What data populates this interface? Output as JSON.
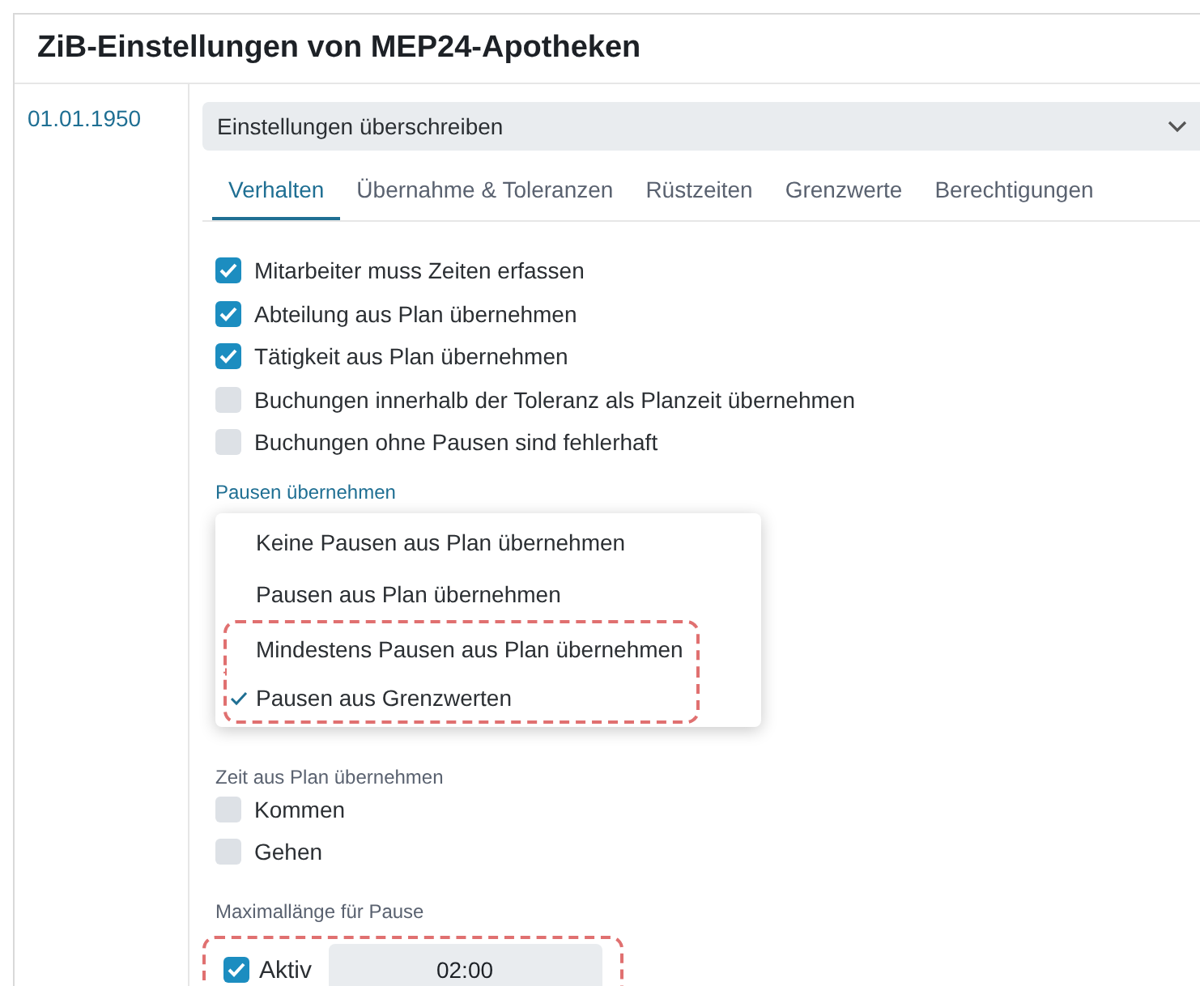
{
  "title": "ZiB-Einstellungen von MEP24-Apotheken",
  "date": "01.01.1950",
  "mode_select": {
    "value": "Einstellungen überschreiben"
  },
  "tabs": [
    {
      "label": "Verhalten",
      "selected": true
    },
    {
      "label": "Übernahme & Toleranzen",
      "selected": false
    },
    {
      "label": "Rüstzeiten",
      "selected": false
    },
    {
      "label": "Grenzwerte",
      "selected": false
    },
    {
      "label": "Berechtigungen",
      "selected": false
    }
  ],
  "options": [
    {
      "label": "Mitarbeiter muss Zeiten erfassen",
      "checked": true
    },
    {
      "label": "Abteilung aus Plan übernehmen",
      "checked": true
    },
    {
      "label": "Tätigkeit aus Plan übernehmen",
      "checked": true
    },
    {
      "label": "Buchungen innerhalb der Toleranz als Planzeit übernehmen",
      "checked": false
    },
    {
      "label": "Buchungen ohne Pausen sind fehlerhaft",
      "checked": false
    }
  ],
  "pausen": {
    "label": "Pausen übernehmen",
    "dropdown": [
      {
        "label": "Keine Pausen aus Plan übernehmen",
        "selected": false,
        "highlighted": false
      },
      {
        "label": "Pausen aus Plan übernehmen",
        "selected": false,
        "highlighted": false
      },
      {
        "label": "Mindestens Pausen aus Plan übernehmen",
        "selected": false,
        "highlighted": true
      },
      {
        "label": "Pausen aus Grenzwerten",
        "selected": true,
        "highlighted": true
      }
    ]
  },
  "zeit": {
    "label": "Zeit aus Plan übernehmen",
    "options": [
      {
        "label": "Kommen",
        "checked": false
      },
      {
        "label": "Gehen",
        "checked": false
      }
    ]
  },
  "max_pause": {
    "label": "Maximallänge für Pause",
    "active_label": "Aktiv",
    "checked": true,
    "value": "02:00",
    "highlighted": true
  }
}
